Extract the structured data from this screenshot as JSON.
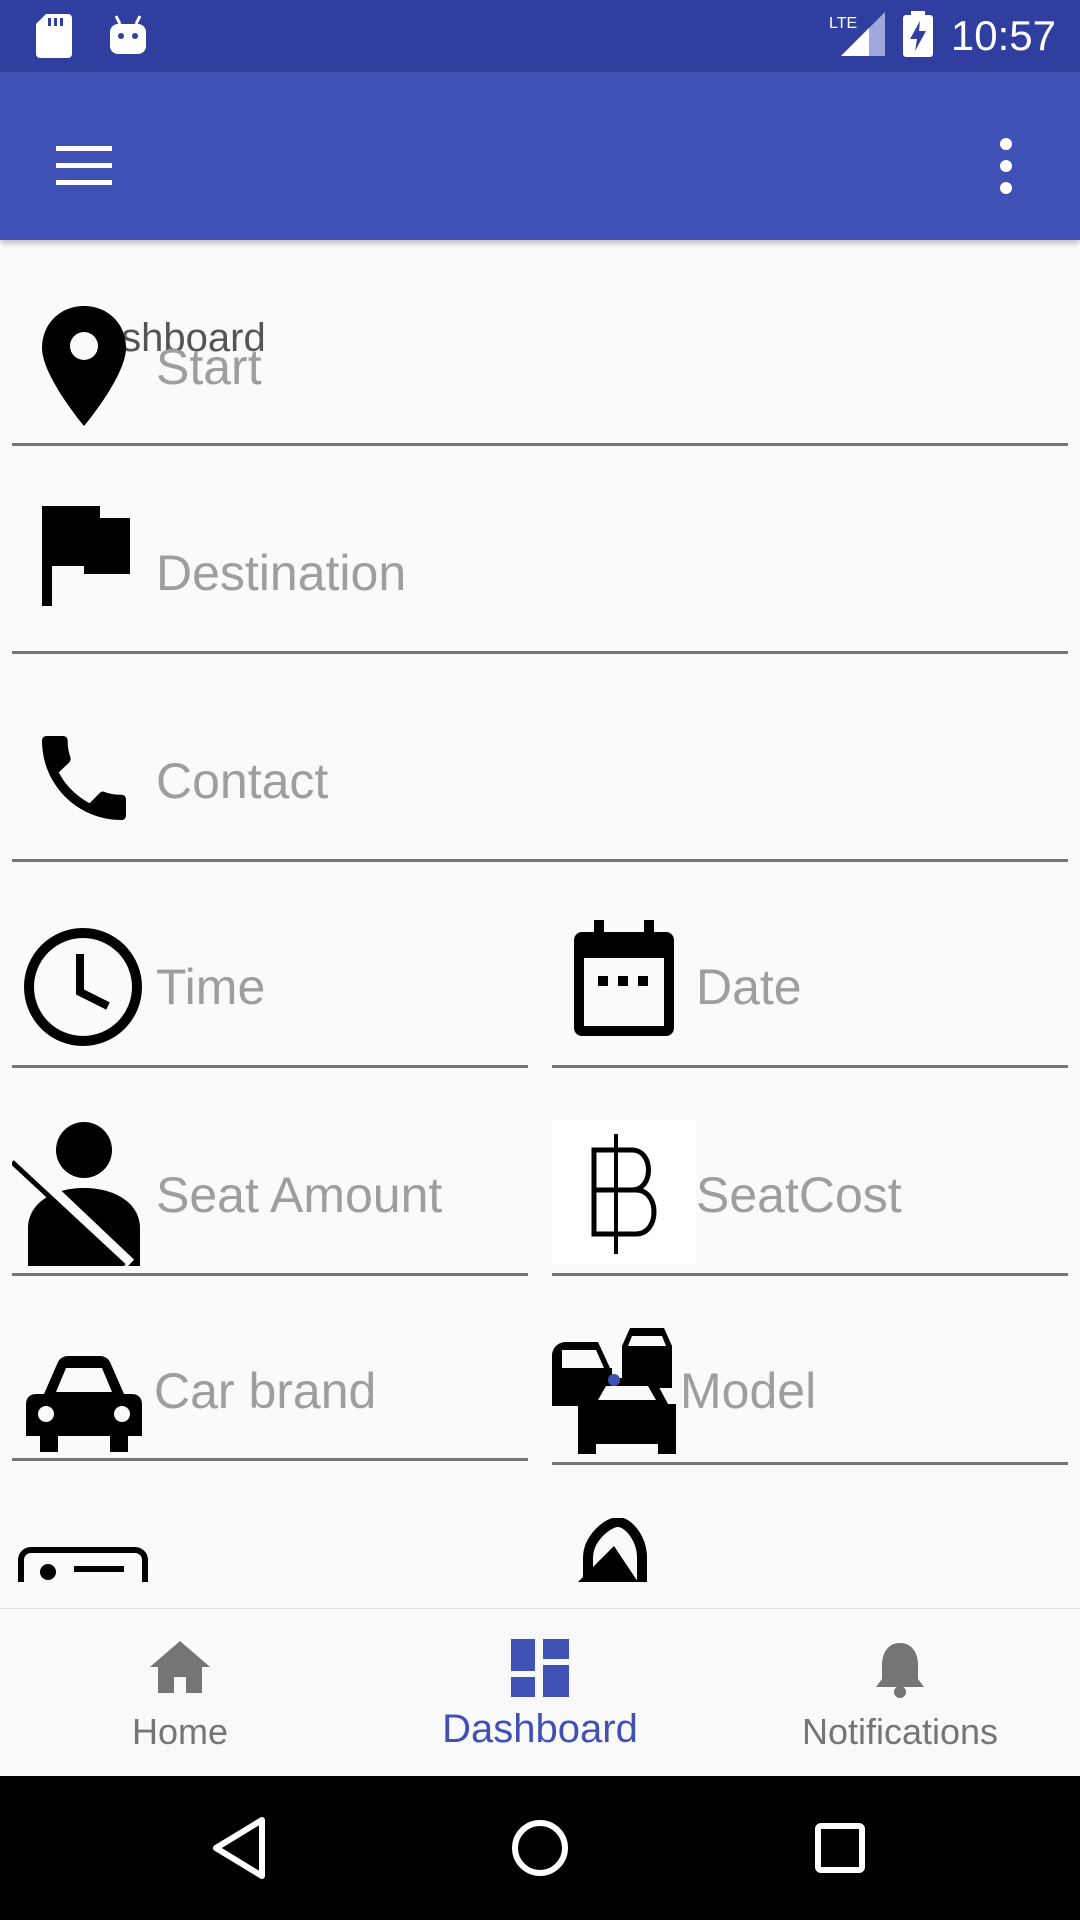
{
  "status_bar": {
    "time": "10:57",
    "network": "LTE",
    "icons": [
      "sd-card-icon",
      "android-icon",
      "lte-signal-icon",
      "battery-charging-icon"
    ]
  },
  "app_bar": {
    "menu_icon": "menu-icon",
    "overflow_icon": "more-vert-icon",
    "title": "Dashboard"
  },
  "form": {
    "start": {
      "placeholder": "Start",
      "icon": "location-pin-icon"
    },
    "destination": {
      "placeholder": "Destination",
      "icon": "flag-icon"
    },
    "contact": {
      "placeholder": "Contact",
      "icon": "phone-icon"
    },
    "time": {
      "placeholder": "Time",
      "icon": "clock-icon"
    },
    "date": {
      "placeholder": "Date",
      "icon": "calendar-icon"
    },
    "seat_amount": {
      "placeholder": "Seat Amount",
      "icon": "seatbelt-icon"
    },
    "seat_cost": {
      "placeholder": "SeatCost",
      "icon": "baht-icon"
    },
    "car_brand": {
      "placeholder": "Car brand",
      "icon": "car-icon"
    },
    "model": {
      "placeholder": "Model",
      "icon": "traffic-cars-icon"
    }
  },
  "bottom_nav": {
    "items": [
      {
        "label": "Home",
        "icon": "home-icon",
        "active": false
      },
      {
        "label": "Dashboard",
        "icon": "dashboard-icon",
        "active": true
      },
      {
        "label": "Notifications",
        "icon": "bell-icon",
        "active": false
      }
    ]
  },
  "system_nav": {
    "icons": [
      "back-icon",
      "home-circle-icon",
      "recents-icon"
    ]
  },
  "colors": {
    "status_bar": "#303f9f",
    "app_bar": "#3f51b5",
    "accent": "#3f51b5",
    "hint_text": "#9e9e9e",
    "background": "#fafafa"
  }
}
